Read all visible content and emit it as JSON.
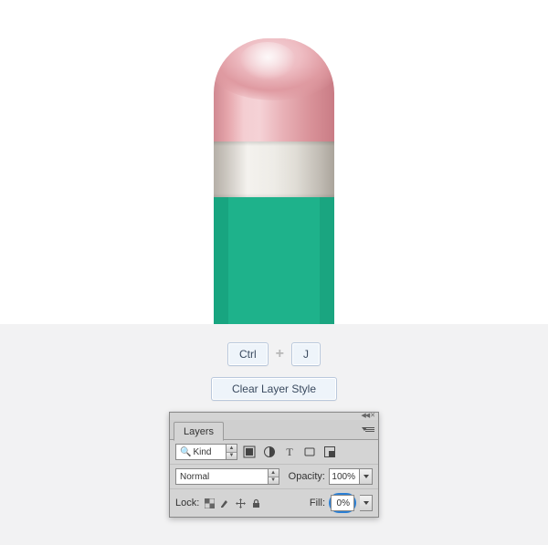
{
  "keys": {
    "ctrl": "Ctrl",
    "j": "J"
  },
  "buttons": {
    "clear_layer_style": "Clear Layer Style"
  },
  "panel": {
    "tab": "Layers",
    "filter_kind": "Kind",
    "blend_mode": "Normal",
    "opacity_label": "Opacity:",
    "opacity_value": "100%",
    "lock_label": "Lock:",
    "fill_label": "Fill:",
    "fill_value": "0%"
  }
}
